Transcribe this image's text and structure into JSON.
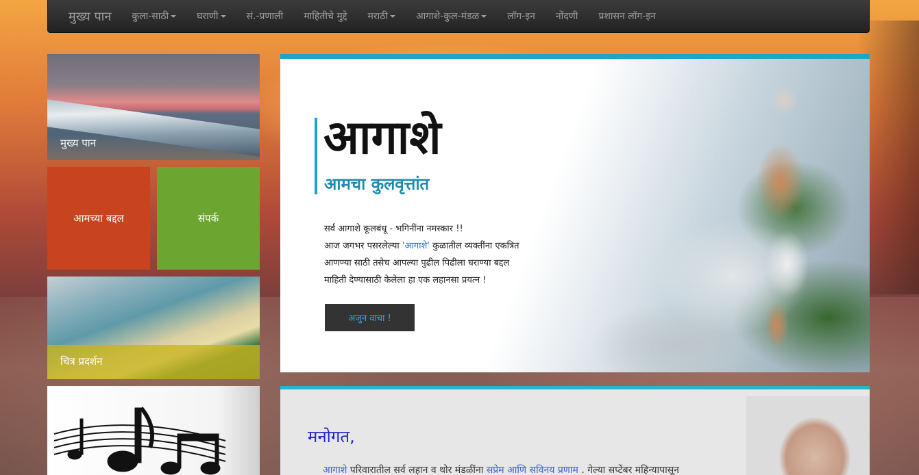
{
  "navbar": {
    "brand": "मुख्य पान",
    "items": [
      {
        "label": "कुला-साठी",
        "dropdown": true
      },
      {
        "label": "घराणी",
        "dropdown": true
      },
      {
        "label": "सं.-प्रणाली",
        "dropdown": false
      },
      {
        "label": "माहितीचे मुद्दे",
        "dropdown": false
      },
      {
        "label": "मराठी",
        "dropdown": true
      },
      {
        "label": "आगाशे-कुल-मंडळ",
        "dropdown": true
      },
      {
        "label": "लॉग-इन",
        "dropdown": false
      },
      {
        "label": "नोंदणी",
        "dropdown": false
      },
      {
        "label": "प्रशासन लॉग-इन",
        "dropdown": false
      }
    ]
  },
  "tiles": {
    "home": "मुख्य पान",
    "about": "आमच्या बद्दल",
    "contact": "संपर्क",
    "gallery": "चित्र प्रदर्शन"
  },
  "hero": {
    "title": "आगाशे",
    "subtitle": "आमचा कुलवृत्तांत",
    "line1": "सर्व आगाशे कूलबंधू - भगिनींना नमस्कार !!",
    "line2_pre": "आज जगभर पसरलेल्या ",
    "line2_hl": "'आगाशे'",
    "line2_post": " कुळातील व्यक्तींना एकत्रित",
    "line3": "आणण्या साठी तसेच आपल्या पुढील पिढीला घराण्या बद्दल",
    "line4": "माहिती देण्यासाठी केलेला हा एक लहानसा प्रयत्न !",
    "button": "अजुन वाचा !"
  },
  "manogat": {
    "title": "मनोगत,",
    "text_hl1": "आगाशे",
    "text_mid": " परिवारातील सर्व लहान व थोर मंडळींना ",
    "text_hl2": "सप्रेम आणि सविनय प्रणाम",
    "text_post": " . गेल्या सप्टेंबर महिन्यापासून"
  },
  "colors": {
    "accent": "#1fa6c6",
    "about_tile": "#c8441e",
    "contact_tile": "#6ca631",
    "gallery_band": "#c8b41e",
    "link": "#3a5bd6"
  }
}
